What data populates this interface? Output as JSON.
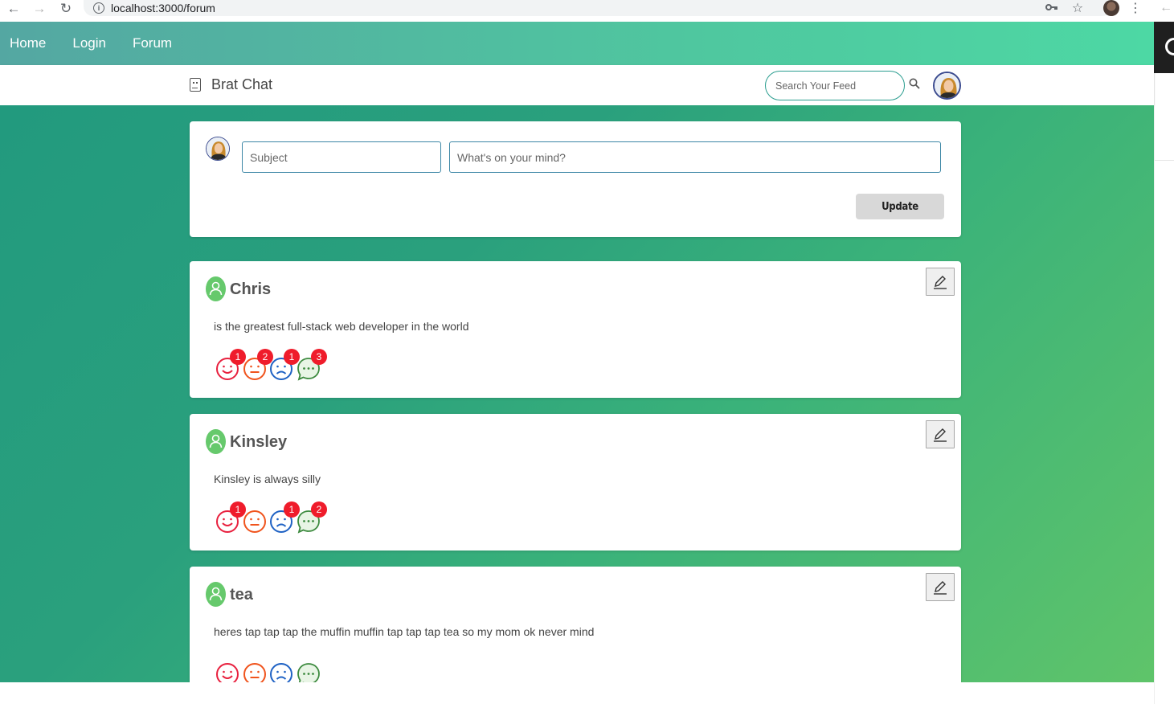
{
  "browser": {
    "url": "localhost:3000/forum"
  },
  "nav": {
    "links": [
      "Home",
      "Login",
      "Forum"
    ]
  },
  "header": {
    "brand": "Brat Chat",
    "search_placeholder": "Search Your Feed"
  },
  "composer": {
    "subject_placeholder": "Subject",
    "mind_placeholder": "What's on your mind?",
    "update_label": "Update"
  },
  "posts": [
    {
      "author": "Chris",
      "body": "is the greatest full-stack web developer in the world",
      "reactions": {
        "happy": "1",
        "neutral": "2",
        "sad": "1",
        "comment": "3"
      }
    },
    {
      "author": "Kinsley",
      "body": "Kinsley is always silly",
      "reactions": {
        "happy": "1",
        "neutral": "",
        "sad": "1",
        "comment": "2"
      }
    },
    {
      "author": "tea",
      "body": "heres tap tap tap the muffin muffin tap tap tap tea so my mom ok never mind",
      "reactions": {
        "happy": "",
        "neutral": "",
        "sad": "",
        "comment": ""
      }
    }
  ],
  "colors": {
    "nav_gradient_start": "#54a7a2",
    "nav_gradient_end": "#4dd8a4",
    "main_bg": "#2aa07d",
    "badge": "#ef1c2b",
    "happy": "#e8203e",
    "neutral": "#f0541d",
    "sad": "#1f62c4",
    "comment": "#3c8a3e"
  }
}
